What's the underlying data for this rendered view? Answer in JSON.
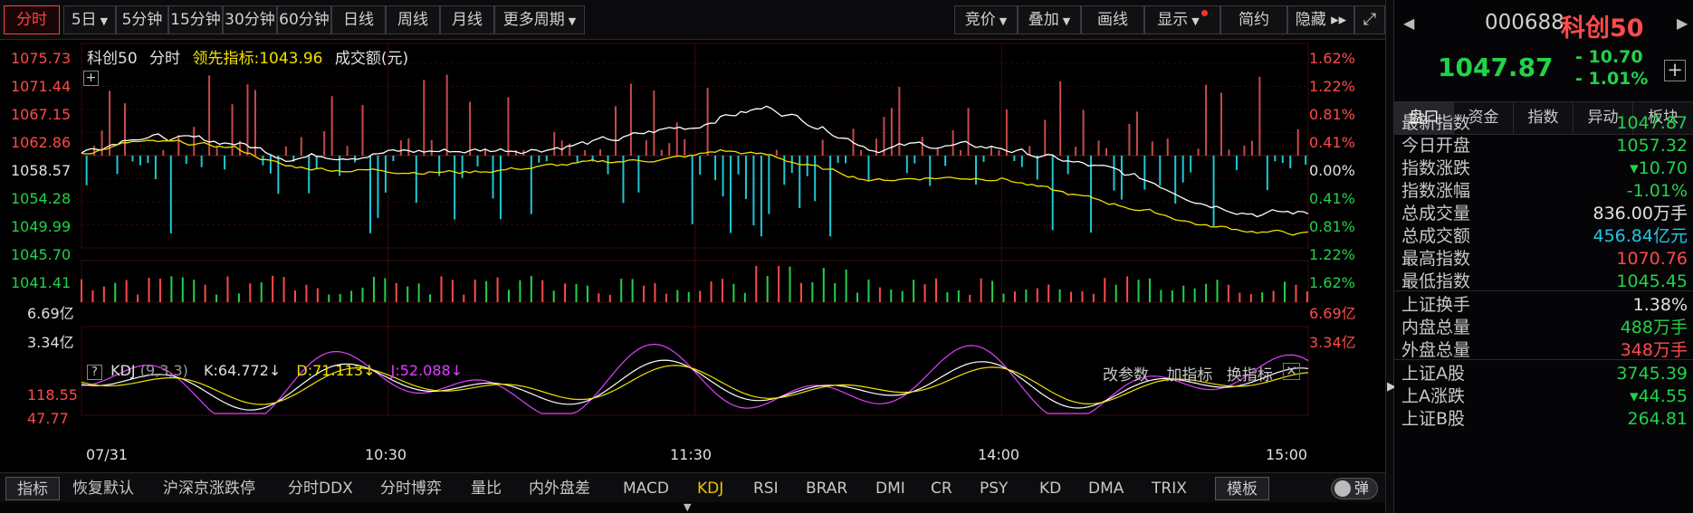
{
  "toolbar": {
    "items": [
      {
        "label": "分时",
        "active": true
      },
      {
        "label": "5日",
        "caret": true
      },
      {
        "label": "5分钟"
      },
      {
        "label": "15分钟"
      },
      {
        "label": "30分钟"
      },
      {
        "label": "60分钟"
      },
      {
        "label": "日线"
      },
      {
        "label": "周线"
      },
      {
        "label": "月线"
      },
      {
        "label": "更多周期",
        "caret": true
      }
    ],
    "right_items": [
      {
        "label": "竞价",
        "caret": true
      },
      {
        "label": "叠加",
        "caret": true
      },
      {
        "label": "画线"
      },
      {
        "label": "显示",
        "caret": true,
        "dot": true
      },
      {
        "label": "简约"
      },
      {
        "label": "隐藏 ▸▸"
      }
    ],
    "fullscreen_icon": "fullscreen-icon"
  },
  "chart": {
    "legend": {
      "name": "科创50",
      "mode": "分时",
      "leading_label": "领先指标:",
      "leading_value": "1043.96",
      "volume_label": "成交额(元)"
    },
    "price_ticks": [
      "1075.73",
      "1071.44",
      "1067.15",
      "1062.86",
      "1058.57",
      "1054.28",
      "1049.99",
      "1045.70",
      "1041.41"
    ],
    "pct_ticks": [
      "1.62%",
      "1.22%",
      "0.81%",
      "0.41%",
      "0.00%",
      "0.41%",
      "0.81%",
      "1.22%",
      "1.62%"
    ],
    "volume_ticks": [
      "6.69亿",
      "3.34亿"
    ],
    "kdj": {
      "help": "?",
      "name": "KDJ",
      "params": "(9,3,3)",
      "k": "K:64.772↓",
      "d": "D:71.113↓",
      "j": "J:52.088↓",
      "ticks": [
        "118.55",
        "47.77"
      ]
    },
    "kdj_actions": [
      "改参数",
      "加指标",
      "换指标"
    ],
    "time_ticks": [
      "07/31",
      "10:30",
      "11:30",
      "14:00",
      "15:00"
    ],
    "colors": {
      "up": "#ff4a4a",
      "down": "#22d24a",
      "price": "#ffffff",
      "avg": "#f0e000",
      "kdj_j": "#e040ff",
      "vol_down_bar": "#1ec8d4"
    }
  },
  "chart_data": {
    "type": "line",
    "x_range": [
      "09:30",
      "15:00"
    ],
    "ylim": [
      1041.41,
      1075.73
    ],
    "baseline": 1058.57,
    "x_ticks": [
      "07/31",
      "10:30",
      "11:30",
      "14:00",
      "15:00"
    ],
    "y_ticks": [
      1075.73,
      1071.44,
      1067.15,
      1062.86,
      1058.57,
      1054.28,
      1049.99,
      1045.7,
      1041.41
    ],
    "series": [
      {
        "name": "科创50",
        "color": "#ffffff",
        "x": [
          "09:30",
          "09:40",
          "09:50",
          "10:00",
          "10:10",
          "10:20",
          "10:30",
          "10:45",
          "11:00",
          "11:15",
          "11:25",
          "11:30",
          "13:05",
          "13:15",
          "13:25",
          "13:35",
          "13:45",
          "14:00",
          "14:10",
          "14:20",
          "14:30",
          "14:40",
          "14:50",
          "15:00"
        ],
        "values": [
          1059.0,
          1062.5,
          1061.5,
          1061.0,
          1058.5,
          1058.8,
          1059.2,
          1059.5,
          1060.0,
          1061.5,
          1063.5,
          1064.0,
          1066.0,
          1067.5,
          1064.0,
          1060.0,
          1060.5,
          1060.0,
          1058.0,
          1056.0,
          1053.5,
          1050.0,
          1048.0,
          1047.87
        ]
      },
      {
        "name": "领先指标",
        "color": "#f0e000",
        "x": [
          "09:30",
          "09:40",
          "09:50",
          "10:00",
          "10:10",
          "10:20",
          "10:30",
          "10:45",
          "11:00",
          "11:15",
          "11:25",
          "11:30",
          "13:05",
          "13:15",
          "13:25",
          "13:35",
          "13:45",
          "14:00",
          "14:10",
          "14:20",
          "14:30",
          "14:40",
          "14:50",
          "15:00"
        ],
        "values": [
          1059.0,
          1061.0,
          1060.8,
          1060.0,
          1056.5,
          1056.0,
          1055.8,
          1055.5,
          1056.5,
          1057.5,
          1058.0,
          1058.5,
          1059.5,
          1058.5,
          1056.0,
          1054.0,
          1054.5,
          1054.5,
          1052.0,
          1050.0,
          1048.0,
          1045.5,
          1044.5,
          1043.96
        ]
      }
    ],
    "volume_ylim": [
      0,
      6.69
    ],
    "kdj_ylim": [
      0,
      118.55
    ]
  },
  "bottombar": {
    "items": [
      {
        "label": "指标",
        "boxed": true
      },
      {
        "label": "恢复默认"
      },
      {
        "label": "沪深京涨跌停"
      },
      {
        "label": "分时DDX"
      },
      {
        "label": "分时博弈"
      },
      {
        "label": "量比"
      },
      {
        "label": "内外盘差"
      },
      {
        "label": "MACD"
      },
      {
        "label": "KDJ",
        "active": true
      },
      {
        "label": "RSI"
      },
      {
        "label": "BRAR"
      },
      {
        "label": "DMI"
      },
      {
        "label": "CR"
      },
      {
        "label": "PSY"
      },
      {
        "label": "KD"
      },
      {
        "label": "DMA"
      },
      {
        "label": "TRIX"
      },
      {
        "label": "模板",
        "boxed": true
      }
    ],
    "toggle_label": "弹"
  },
  "panel": {
    "code": "000688",
    "name": "科创50",
    "price": "1047.87",
    "change": "- 10.70",
    "change_pct": "- 1.01%",
    "tabs": [
      "盘口",
      "资金",
      "指数",
      "异动",
      "板块"
    ],
    "rows": [
      {
        "label": "最新指数",
        "value": "1047.87",
        "color": "#22d24a"
      },
      {
        "label": "今日开盘",
        "value": "1057.32",
        "color": "#22d24a"
      },
      {
        "label": "指数涨跌",
        "value": "▾10.70",
        "color": "#22d24a"
      },
      {
        "label": "指数涨幅",
        "value": "-1.01%",
        "color": "#22d24a"
      },
      {
        "label": "总成交量",
        "value": "836.00",
        "unit": "万手",
        "color": "#e0e0e0"
      },
      {
        "label": "总成交额",
        "value": "456.84",
        "unit": "亿元",
        "color": "#20c8e0"
      },
      {
        "label": "最高指数",
        "value": "1070.76",
        "color": "#ff4a4a"
      },
      {
        "label": "最低指数",
        "value": "1045.45",
        "color": "#22d24a"
      },
      {
        "label": "上证换手",
        "value": "1.38%",
        "color": "#e0e0e0"
      },
      {
        "label": "内盘总量",
        "value": "488",
        "unit": "万手",
        "color": "#22d24a"
      },
      {
        "label": "外盘总量",
        "value": "348",
        "unit": "万手",
        "color": "#ff4a4a"
      },
      {
        "label": "上证A股",
        "value": "3745.39",
        "color": "#22d24a"
      },
      {
        "label": "上A涨跌",
        "value": "▾44.55",
        "color": "#22d24a"
      },
      {
        "label": "上证B股",
        "value": "264.81",
        "color": "#22d24a"
      }
    ]
  }
}
